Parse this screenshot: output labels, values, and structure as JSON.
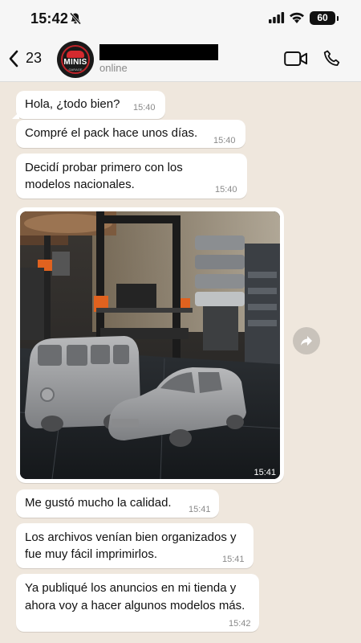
{
  "status_bar": {
    "time": "15:42",
    "battery": "60"
  },
  "header": {
    "back_count": "23",
    "avatar_label": "MINIS",
    "avatar_sub": "GARAGE",
    "contact_status": "online"
  },
  "messages": [
    {
      "text_lines": [
        "Hola, ¿todo bien?"
      ],
      "time": "15:40"
    },
    {
      "text_lines": [
        "Compré el pack hace unos días."
      ],
      "time": "15:40"
    },
    {
      "text_lines": [
        "Decidí probar primero con los",
        "modelos nacionales."
      ],
      "time": "15:40"
    },
    {
      "type": "image",
      "time": "15:41"
    },
    {
      "text_lines": [
        "Me gustó mucho la calidad."
      ],
      "time": "15:41"
    },
    {
      "text_lines": [
        "Los archivos venían bien organizados y",
        "fue muy fácil imprimirlos."
      ],
      "time": "15:41"
    },
    {
      "text_lines": [
        "Ya publiqué los anuncios en mi tienda y",
        "ahora voy a hacer algunos modelos más."
      ],
      "time": "15:42"
    }
  ]
}
